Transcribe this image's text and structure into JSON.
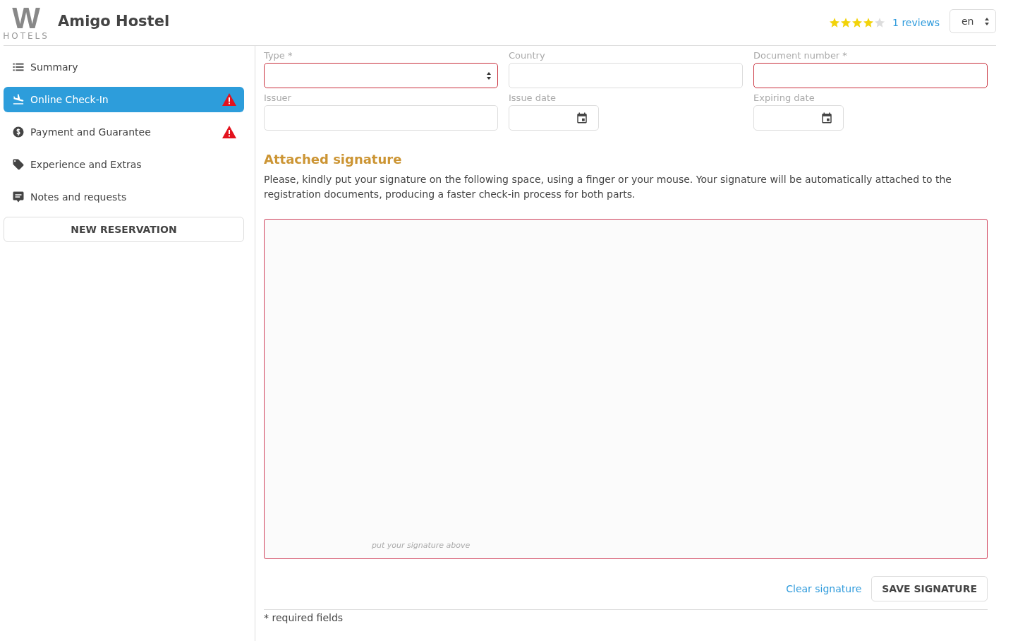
{
  "header": {
    "logo": {
      "mark": "W",
      "text": "HOTELS"
    },
    "title": "Amigo Hostel",
    "rating": {
      "stars": 4
    },
    "reviews": "1 reviews",
    "language": "en"
  },
  "sidebar": {
    "items": [
      {
        "kind": "list",
        "label": "Summary",
        "selected": false,
        "warning": false
      },
      {
        "kind": "plane",
        "label": "Online Check-In",
        "selected": true,
        "warning": true
      },
      {
        "kind": "dollar",
        "label": "Payment and Guarantee",
        "selected": false,
        "warning": true
      },
      {
        "kind": "tag",
        "label": "Experience and Extras",
        "selected": false,
        "warning": false
      },
      {
        "kind": "chat",
        "label": "Notes and requests",
        "selected": false,
        "warning": false
      }
    ],
    "button": "NEW RESERVATION"
  },
  "form": {
    "fields": [
      {
        "kind": "select",
        "label": "Type *",
        "invalid": true
      },
      {
        "kind": "text",
        "label": "Country",
        "invalid": false
      },
      {
        "kind": "text",
        "label": "Document number *",
        "invalid": true
      },
      {
        "kind": "text",
        "label": "Issuer",
        "invalid": false
      },
      {
        "kind": "date",
        "label": "Issue date",
        "invalid": false
      },
      {
        "kind": "date",
        "label": "Expiring date",
        "invalid": false
      }
    ]
  },
  "signature": {
    "heading": "Attached signature",
    "description": "Please, kindly put your signature on the following space, using a finger or your mouse. Your signature will be automatically attached to the registration documents, producing a faster check-in process for both parts.",
    "invalid": true,
    "hint": "put your signature above",
    "clear": "Clear signature",
    "save": "SAVE SIGNATURE"
  },
  "footnote": "* required fields"
}
